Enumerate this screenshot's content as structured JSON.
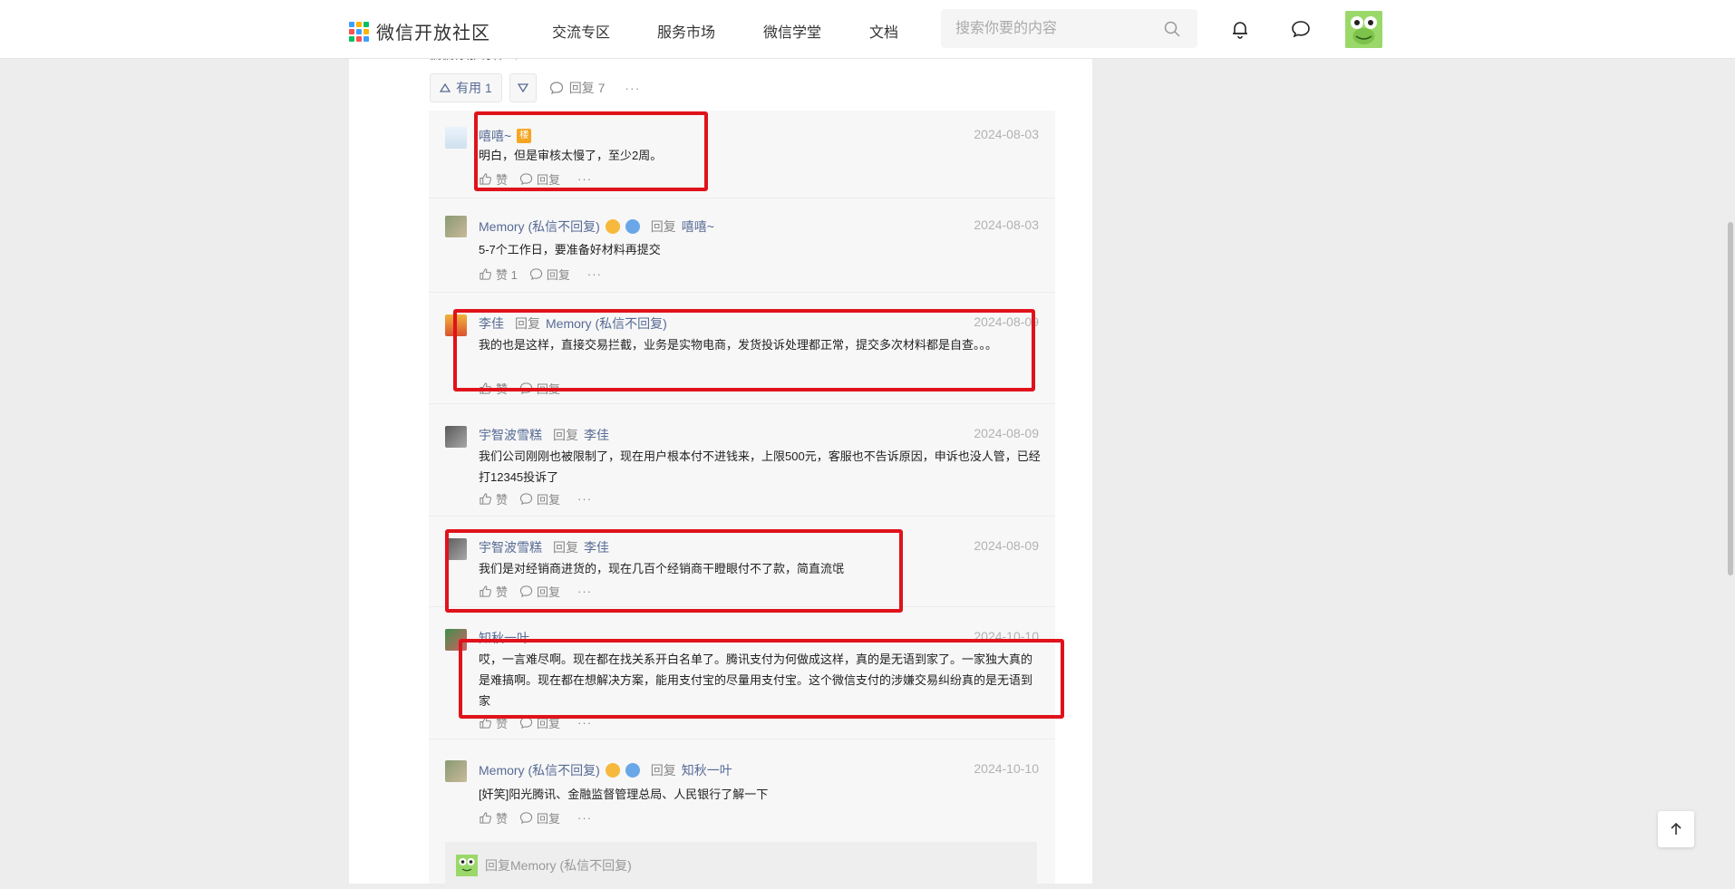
{
  "header": {
    "logo_text": "微信开放社区",
    "nav": [
      "交流专区",
      "服务市场",
      "微信学堂",
      "文档"
    ],
    "search_placeholder": "搜索你要的内容"
  },
  "post_actions": {
    "partial_text": "偏偏你那有什么一?",
    "useful_label": "有用 1",
    "reply_label": "回复 7",
    "more": "···"
  },
  "comments": [
    {
      "name": "嘻嘻~",
      "badge_text": "楼",
      "date": "2024-08-03",
      "body": "明白，但是审核太慢了，至少2周。",
      "like": "赞",
      "reply": "回复",
      "more": "···"
    },
    {
      "name": "Memory (私信不回复)",
      "reply_word": "回复",
      "to": "嘻嘻~",
      "date": "2024-08-03",
      "body": "5-7个工作日，要准备好材料再提交",
      "like": "赞 1",
      "reply": "回复",
      "more": "···"
    },
    {
      "name": "李佳",
      "reply_word": "回复",
      "to": "Memory (私信不回复)",
      "date": "2024-08-09",
      "body": "我的也是这样，直接交易拦截，业务是实物电商，发货投诉处理都正常，提交多次材料都是自查。。。",
      "like": "赞",
      "reply": "回复",
      "more": "···"
    },
    {
      "name": "宇智波雪糕",
      "reply_word": "回复",
      "to": "李佳",
      "date": "2024-08-09",
      "body": "我们公司刚刚也被限制了，现在用户根本付不进钱来，上限500元，客服也不告诉原因，申诉也没人管，已经打12345投诉了",
      "like": "赞",
      "reply": "回复",
      "more": "···"
    },
    {
      "name": "宇智波雪糕",
      "reply_word": "回复",
      "to": "李佳",
      "date": "2024-08-09",
      "body": "我们是对经销商进货的，现在几百个经销商干瞪眼付不了款，简直流氓",
      "like": "赞",
      "reply": "回复",
      "more": "···"
    },
    {
      "name": "知秋一叶",
      "date": "2024-10-10",
      "body": "哎，一言难尽啊。现在都在找关系开白名单了。腾讯支付为何做成这样，真的是无语到家了。一家独大真的是难搞啊。现在都在想解决方案，能用支付宝的尽量用支付宝。这个微信支付的涉嫌交易纠纷真的是无语到家",
      "like": "赞",
      "reply": "回复",
      "more": "···"
    },
    {
      "name": "Memory (私信不回复)",
      "reply_word": "回复",
      "to": "知秋一叶",
      "date": "2024-10-10",
      "body": "[奸笑]阳光腾讯、金融监督管理总局、人民银行了解一下",
      "like": "赞",
      "reply": "回复",
      "more": "···"
    }
  ],
  "reply_box": {
    "placeholder": "回复Memory (私信不回复)"
  },
  "colors": {
    "accent": "#576b95",
    "highlight": "#e0121b",
    "thread_bg": "#f7f7f7"
  }
}
